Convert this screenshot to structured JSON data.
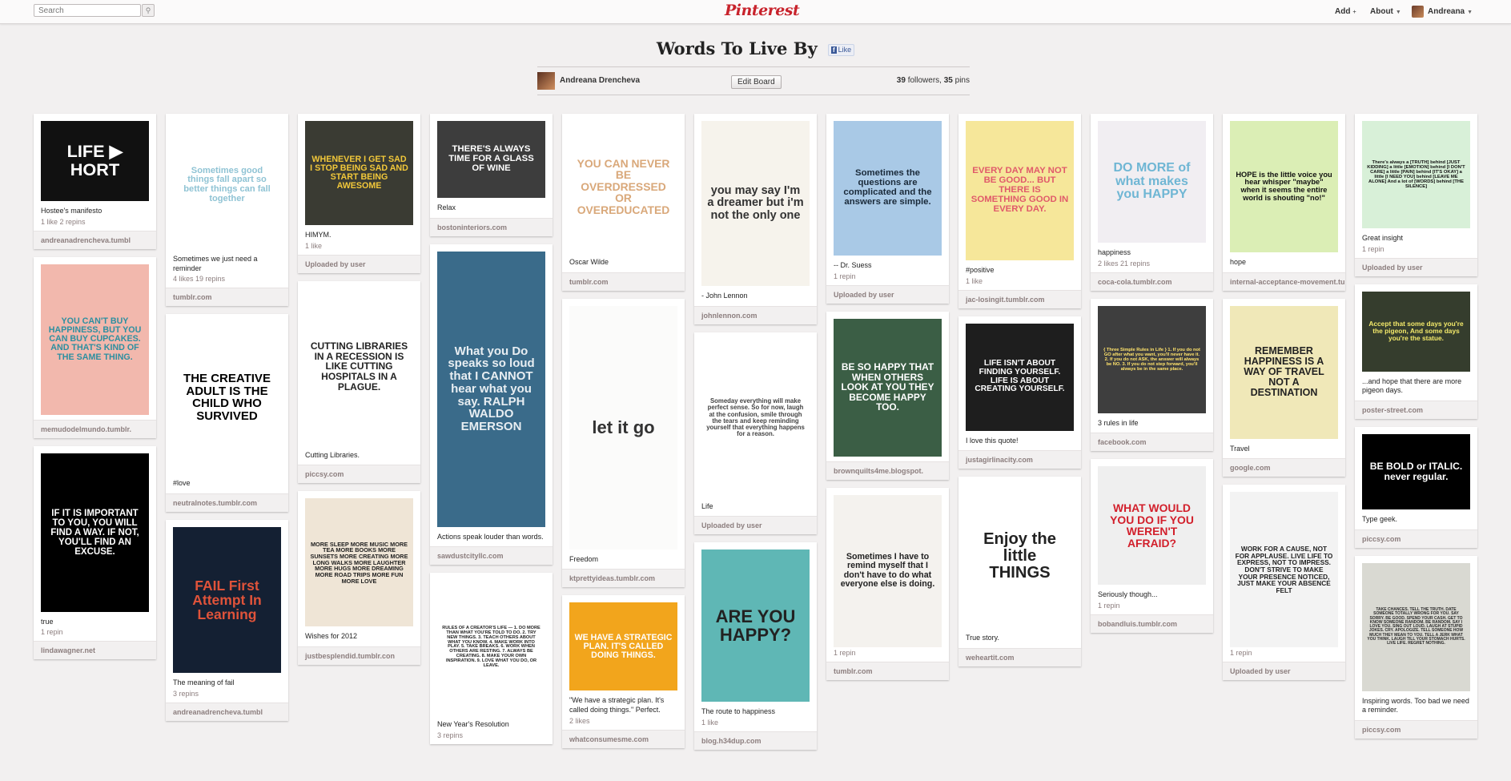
{
  "header": {
    "search_placeholder": "Search",
    "search_icon": "magnifier-icon",
    "logo": "Pinterest",
    "add_label": "Add",
    "about_label": "About",
    "user_label": "Andreana"
  },
  "board": {
    "title": "Words To Live By",
    "fb_like": "Like",
    "owner": "Andreana Drencheva",
    "edit_label": "Edit Board",
    "followers": "39",
    "followers_label": "followers,",
    "pins": "35",
    "pins_label": "pins"
  },
  "columns": [
    [
      {
        "img_text": "LIFE ▶ HORT",
        "bg": "#111",
        "fg": "#fff",
        "h": 100,
        "desc": "Hostee's manifesto",
        "counts": "1 like  2 repins",
        "src": "andreanadrencheva.tumbl"
      },
      {
        "img_text": "YOU CAN'T BUY HAPPINESS, BUT YOU CAN BUY CUPCAKES. AND THAT'S KIND OF THE SAME THING.",
        "bg": "#f2b8ad",
        "fg": "#2d8fa0",
        "h": 188,
        "desc": "",
        "counts": "",
        "src": "memudodelmundo.tumblr."
      },
      {
        "img_text": "IF IT IS IMPORTANT TO YOU, YOU WILL FIND A WAY. IF NOT, YOU'LL FIND AN EXCUSE.",
        "bg": "#000",
        "fg": "#fff",
        "h": 198,
        "desc": "true",
        "counts": "1 repin",
        "src": "lindawagner.net"
      }
    ],
    [
      {
        "img_text": "Sometimes good things fall apart so better things can fall together",
        "bg": "#fff",
        "fg": "#8fc3d4",
        "h": 160,
        "desc": "Sometimes we just need a reminder",
        "counts": "4 likes  19 repins",
        "src": "tumblr.com"
      },
      {
        "img_text": "THE CREATIVE ADULT IS THE CHILD WHO SURVIVED",
        "bg": "#fff",
        "fg": "#000",
        "h": 190,
        "desc": "#love",
        "counts": "",
        "src": "neutralnotes.tumblr.com"
      },
      {
        "img_text": "FAIL  First Attempt In Learning",
        "bg": "#142033",
        "fg": "#e0533a",
        "h": 182,
        "desc": "The meaning of fail",
        "counts": "3 repins",
        "src": "andreanadrencheva.tumbl"
      }
    ],
    [
      {
        "img_text": "WHENEVER I GET SAD I STOP BEING SAD AND START BEING AWESOME",
        "bg": "#3a3b33",
        "fg": "#f2c83a",
        "h": 130,
        "desc": "HIMYM.",
        "counts": "1 like",
        "src": "Uploaded by user"
      },
      {
        "img_text": "CUTTING LIBRARIES IN A RECESSION IS LIKE CUTTING HOSPITALS IN A PLAGUE.",
        "bg": "#fff",
        "fg": "#222",
        "h": 196,
        "desc": "Cutting Libraries.",
        "counts": "",
        "src": "piccsy.com"
      },
      {
        "img_text": "MORE SLEEP MORE MUSIC MORE TEA MORE BOOKS MORE SUNSETS MORE CREATING MORE LONG WALKS MORE LAUGHTER MORE HUGS MORE DREAMING MORE ROAD TRIPS MORE FUN MORE LOVE",
        "bg": "#efe5d6",
        "fg": "#222",
        "h": 160,
        "desc": "Wishes for 2012",
        "counts": "",
        "src": "justbesplendid.tumblr.con"
      }
    ],
    [
      {
        "img_text": "THERE'S ALWAYS TIME FOR A GLASS OF WINE",
        "bg": "#3d3d3d",
        "fg": "#fff",
        "h": 96,
        "desc": "Relax",
        "counts": "",
        "src": "bostoninteriors.com"
      },
      {
        "img_text": "What you Do speaks so loud that I CANNOT hear what you say. RALPH WALDO EMERSON",
        "bg": "#3a6b8a",
        "fg": "#e8eef2",
        "h": 344,
        "desc": "Actions speak louder than words.",
        "counts": "",
        "src": "sawdustcityllc.com"
      },
      {
        "img_text": "RULES OF A CREATOR'S LIFE — 1. DO MORE THAN WHAT YOU'RE TOLD TO DO. 2. TRY NEW THINGS. 3. TEACH OTHERS ABOUT WHAT YOU KNOW. 4. MAKE WORK INTO PLAY. 5. TAKE BREAKS. 6. WORK WHEN OTHERS ARE RESTING. 7. ALWAYS BE CREATING. 8. MAKE YOUR OWN INSPIRATION. 9. LOVE WHAT YOU DO, OR LEAVE.",
        "bg": "#fff",
        "fg": "#222",
        "h": 168,
        "desc": "New Year's Resolution",
        "counts": "3 repins",
        "src": ""
      }
    ],
    [
      {
        "img_text": "YOU CAN NEVER BE OVERDRESSED OR OVEREDUCATED",
        "bg": "#fff",
        "fg": "#d9a87a",
        "h": 164,
        "desc": "Oscar Wilde",
        "counts": "",
        "src": "tumblr.com"
      },
      {
        "img_text": "let it go",
        "bg": "#fbfbfa",
        "fg": "#333",
        "h": 304,
        "desc": "Freedom",
        "counts": "",
        "src": "ktprettyideas.tumblr.com"
      },
      {
        "img_text": "WE HAVE A STRATEGIC PLAN. IT'S CALLED DOING THINGS.",
        "bg": "#f2a51c",
        "fg": "#fff",
        "h": 110,
        "desc": "\"We have a strategic plan. It's called doing things.\" Perfect.",
        "counts": "2 likes",
        "src": "whatconsumesme.com"
      }
    ],
    [
      {
        "img_text": "you may say I'm a dreamer  but i'm not the only one",
        "bg": "#f6f3ec",
        "fg": "#333",
        "h": 206,
        "desc": "- John Lennon",
        "counts": "",
        "src": "johnlennon.com"
      },
      {
        "img_text": "Someday everything will make perfect sense. So for now, laugh at the confusion, smile through the tears and keep reminding yourself that everything happens for a reason.",
        "bg": "#fff",
        "fg": "#444",
        "h": 196,
        "desc": "Life",
        "counts": "",
        "src": "Uploaded by user"
      },
      {
        "img_text": "ARE YOU HAPPY?",
        "bg": "#5fb7b5",
        "fg": "#222",
        "h": 190,
        "desc": "The route to happiness",
        "counts": "1 like",
        "src": "blog.h34dup.com"
      }
    ],
    [
      {
        "img_text": "Sometimes the questions are complicated and the answers are simple.",
        "bg": "#a9c9e6",
        "fg": "#1a2a3a",
        "h": 168,
        "desc": "-- Dr. Suess",
        "counts": "1 repin",
        "src": "Uploaded by user"
      },
      {
        "img_text": "BE SO HAPPY THAT WHEN OTHERS LOOK AT YOU THEY BECOME HAPPY TOO.",
        "bg": "#3b5e45",
        "fg": "#fff",
        "h": 172,
        "desc": "",
        "counts": "",
        "src": "brownquilts4me.blogspot."
      },
      {
        "img_text": "Sometimes I have to remind myself that I don't have to do what everyone else is doing.",
        "bg": "#f4f2ee",
        "fg": "#222",
        "h": 190,
        "desc": "",
        "counts": "1 repin",
        "src": "tumblr.com"
      }
    ],
    [
      {
        "img_text": "EVERY DAY MAY NOT BE GOOD... BUT THERE IS SOMETHING GOOD IN EVERY DAY.",
        "bg": "#f6e79a",
        "fg": "#e05a6a",
        "h": 174,
        "desc": "#positive",
        "counts": "1 like",
        "src": "jac-losingit.tumblr.com"
      },
      {
        "img_text": "LIFE ISN'T ABOUT FINDING YOURSELF. LIFE IS ABOUT CREATING YOURSELF.",
        "bg": "#1e1e1e",
        "fg": "#fff",
        "h": 134,
        "desc": "I love this quote!",
        "counts": "",
        "src": "justagirlinacity.com"
      },
      {
        "img_text": "Enjoy the little THINGS",
        "bg": "#fff",
        "fg": "#222",
        "h": 180,
        "desc": "True story.",
        "counts": "",
        "src": "weheartit.com"
      }
    ],
    [
      {
        "img_text": "DO MORE of what makes you HAPPY",
        "bg": "#f1eef2",
        "fg": "#6fb6d4",
        "h": 152,
        "desc": "happiness",
        "counts": "2 likes  21 repins",
        "src": "coca-cola.tumblr.com"
      },
      {
        "img_text": "{ Three Simple Rules in Life } 1. If you do not GO after what you want, you'll never have it. 2. If you do not ASK, the answer will always be NO. 3. If you do not step forward, you'll always be in the same place.",
        "bg": "#3e3e3e",
        "fg": "#ffe36b",
        "h": 134,
        "desc": "3 rules in life",
        "counts": "",
        "src": "facebook.com"
      },
      {
        "img_text": "WHAT WOULD YOU DO IF YOU WEREN'T AFRAID?",
        "bg": "#efefef",
        "fg": "#d21f2b",
        "h": 148,
        "desc": "Seriously though...",
        "counts": "1 repin",
        "src": "bobandluis.tumblr.com"
      }
    ],
    [
      {
        "img_text": "HOPE is the little voice you hear whisper \"maybe\" when it seems the entire world is shouting \"no!\"",
        "bg": "#dbeeb5",
        "fg": "#111",
        "h": 164,
        "desc": "hope",
        "counts": "",
        "src": "internal-acceptance-movement.tumblr.com"
      },
      {
        "img_text": "REMEMBER HAPPINESS IS A WAY OF TRAVEL NOT A DESTINATION",
        "bg": "#f0e8b8",
        "fg": "#222",
        "h": 166,
        "desc": "Travel",
        "counts": "",
        "src": "google.com"
      },
      {
        "img_text": "WORK FOR A CAUSE, NOT FOR APPLAUSE. LIVE LIFE TO EXPRESS, NOT TO IMPRESS. DON'T STRIVE TO MAKE YOUR PRESENCE NOTICED, JUST MAKE YOUR ABSENCE FELT",
        "bg": "#f3f3f3",
        "fg": "#222",
        "h": 194,
        "desc": "",
        "counts": "1 repin",
        "src": "Uploaded by user"
      }
    ],
    [
      {
        "img_text": "There's always a [TRUTH] behind [JUST KIDDING] a little [EMOTION] behind [I DON'T CARE] a little [PAIN] behind [IT'S OKAY] a little [I NEED YOU] behind [LEAVE ME ALONE] And a lot of [WORDS] behind [THE SILENCE]",
        "bg": "#d8f0d8",
        "fg": "#111",
        "h": 134,
        "desc": "Great insight",
        "counts": "1 repin",
        "src": "Uploaded by user"
      },
      {
        "img_text": "Accept that some days you're the pigeon, And some days you're the statue.",
        "bg": "#353d2d",
        "fg": "#f3e96a",
        "h": 100,
        "desc": "...and hope that there are more pigeon days.",
        "counts": "",
        "src": "poster-street.com"
      },
      {
        "img_text": "BE BOLD or ITALIC. never regular.",
        "bg": "#000",
        "fg": "#fff",
        "h": 94,
        "desc": "Type geek.",
        "counts": "",
        "src": "piccsy.com"
      },
      {
        "img_text": "TAKE CHANCES. TELL THE TRUTH. DATE SOMEONE TOTALLY WRONG FOR YOU. SAY SORRY. BE GOOD. SPEND YOUR CASH. GET TO KNOW SOMEONE RANDOM. BE RANDOM. SAY I LOVE YOU. SING OUT LOUD. LAUGH AT STUPID JOKES. CRY. APOLOGIZE. TELL SOMEONE HOW MUCH THEY MEAN TO YOU. TELL A JERK WHAT YOU THINK. LAUGH TILL YOUR STOMACH HURTS. LIVE LIFE. REGRET NOTHING.",
        "bg": "#d9d9d2",
        "fg": "#2a2a2a",
        "h": 160,
        "desc": "Inspiring words. Too bad we need a reminder.",
        "counts": "",
        "src": "piccsy.com"
      }
    ]
  ]
}
